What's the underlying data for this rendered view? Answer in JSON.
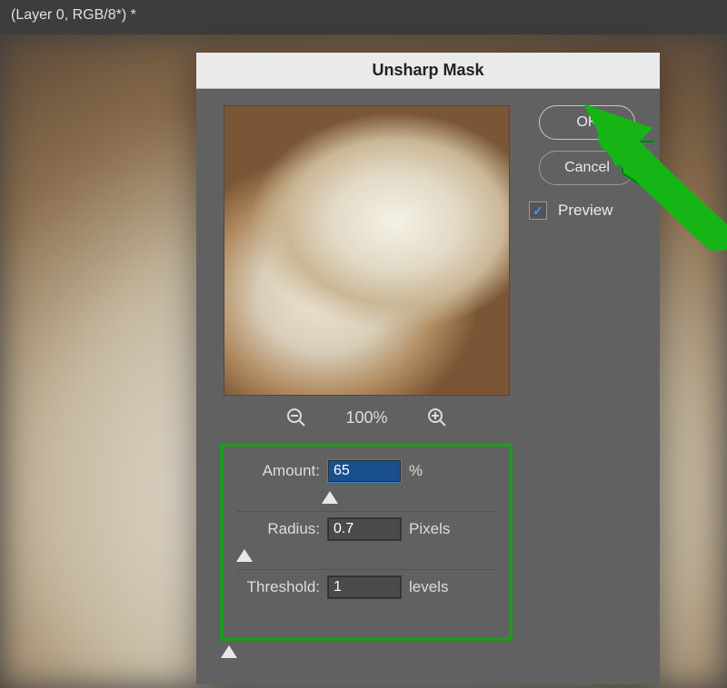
{
  "top_bar": {
    "document_label": "(Layer 0, RGB/8*) *"
  },
  "dialog": {
    "title": "Unsharp Mask",
    "buttons": {
      "ok": "OK",
      "cancel": "Cancel"
    },
    "preview_checkbox_label": "Preview",
    "preview_checked": "✓",
    "zoom": {
      "level": "100%"
    },
    "settings": {
      "amount_label": "Amount:",
      "amount_value": "65",
      "amount_unit": "%",
      "radius_label": "Radius:",
      "radius_value": "0.7",
      "radius_unit": "Pixels",
      "threshold_label": "Threshold:",
      "threshold_value": "1",
      "threshold_unit": "levels"
    }
  }
}
